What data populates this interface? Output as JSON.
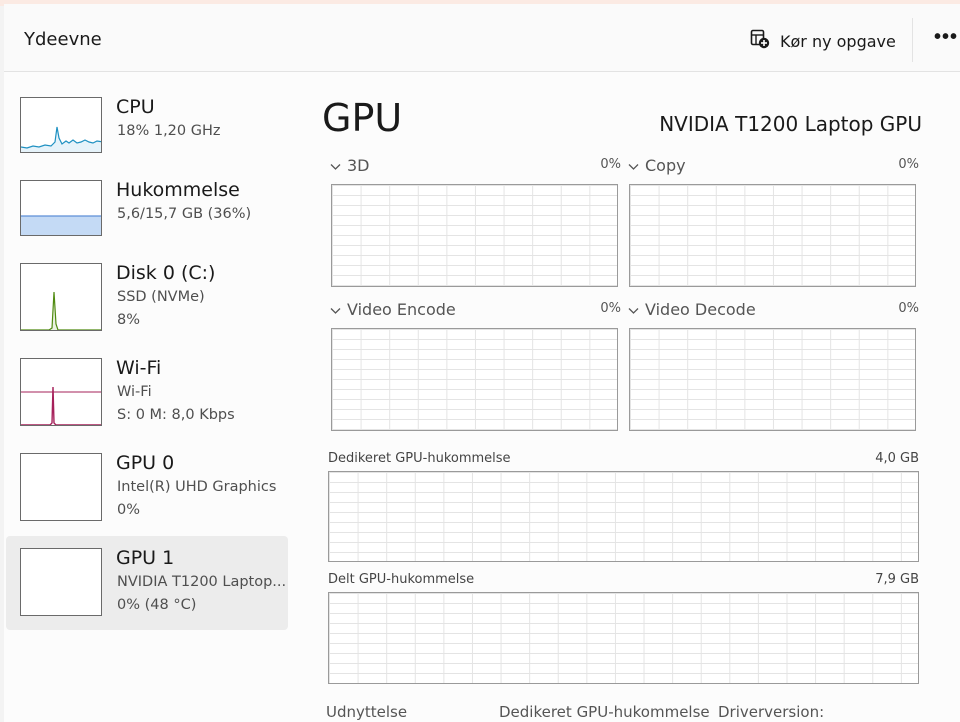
{
  "header": {
    "title": "Ydeevne",
    "run_task_label": "Kør ny opgave",
    "run_task_icon": "new-task-icon",
    "more_label": "•••"
  },
  "sidebar": {
    "items": [
      {
        "name": "CPU",
        "sub1": "18%  1,20 GHz",
        "sub2": "",
        "graph_color": "#1f91c2",
        "graph_fill": "#e6f3fa"
      },
      {
        "name": "Hukommelse",
        "sub1": "5,6/15,7 GB (36%)",
        "sub2": "",
        "graph_color": "#5e8fd6",
        "graph_fill": "#c4daf5",
        "level": 0.36
      },
      {
        "name": "Disk 0 (C:)",
        "sub1": "SSD (NVMe)",
        "sub2": "8%",
        "graph_color": "#4f8a10",
        "graph_fill": "#eaf2e0"
      },
      {
        "name": "Wi-Fi",
        "sub1": "Wi-Fi",
        "sub2": "S: 0  M: 8,0 Kbps",
        "graph_color": "#a6205a",
        "graph_fill": "#fff"
      },
      {
        "name": "GPU 0",
        "sub1": "Intel(R) UHD Graphics",
        "sub2": "0%",
        "graph_color": "#1f91c2",
        "graph_fill": "#fff"
      },
      {
        "name": "GPU 1",
        "sub1": "NVIDIA T1200 Laptop...",
        "sub2": "0%  (48 °C)",
        "graph_color": "#1f91c2",
        "graph_fill": "#fff",
        "selected": true
      }
    ]
  },
  "main": {
    "title": "GPU",
    "model": "NVIDIA T1200 Laptop GPU",
    "engines": [
      {
        "label": "3D",
        "value": "0%"
      },
      {
        "label": "Copy",
        "value": "0%"
      },
      {
        "label": "Video Encode",
        "value": "0%"
      },
      {
        "label": "Video Decode",
        "value": "0%"
      }
    ],
    "dedicated_memory": {
      "label": "Dedikeret GPU-hukommelse",
      "value": "4,0 GB"
    },
    "shared_memory": {
      "label": "Delt GPU-hukommelse",
      "value": "7,9 GB"
    },
    "stats": {
      "utilization_label": "Udnyttelse",
      "dedicated_label": "Dedikeret GPU-hukommelse",
      "driver_label": "Driverversion:"
    }
  }
}
